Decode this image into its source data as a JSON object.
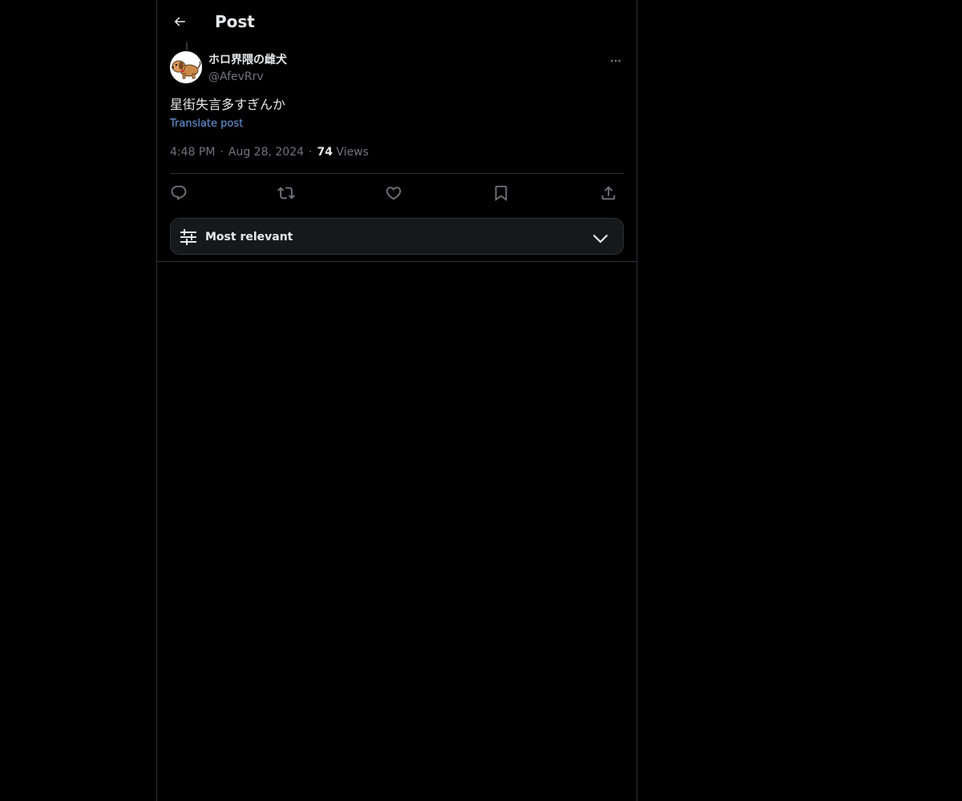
{
  "header": {
    "title": "Post",
    "back_icon": "arrow-left-icon"
  },
  "post": {
    "author": {
      "display_name": "ホロ界隈の雌犬",
      "handle": "@AfevRrv",
      "avatar_icon": "dog-avatar"
    },
    "text": "星街失言多すぎんか",
    "translate_label": "Translate post",
    "time": "4:48 PM",
    "date": "Aug 28, 2024",
    "views_count": "74",
    "views_label": "Views",
    "meta_separator": "·"
  },
  "actions": {
    "reply_icon": "reply-icon",
    "repost_icon": "repost-icon",
    "like_icon": "heart-icon",
    "bookmark_icon": "bookmark-icon",
    "share_icon": "share-icon"
  },
  "replies_sort": {
    "label": "Most relevant",
    "icon": "sliders-icon",
    "chevron": "chevron-down-icon"
  },
  "colors": {
    "background": "#000000",
    "text": "#e7e9ea",
    "muted": "#71767b",
    "link": "#6a9fe6",
    "border": "#2f3336"
  }
}
